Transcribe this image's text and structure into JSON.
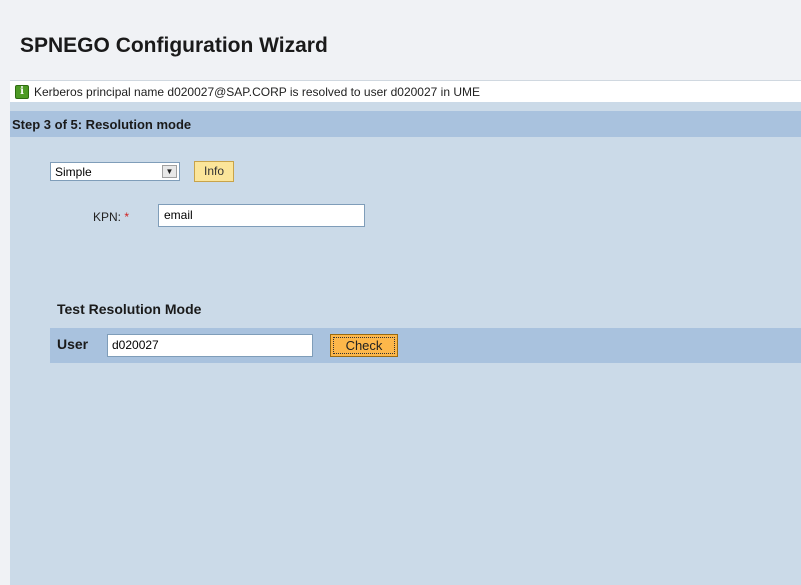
{
  "header": {
    "title": "SPNEGO Configuration Wizard"
  },
  "message": {
    "icon": "info-icon",
    "text": "Kerberos principal name d020027@SAP.CORP is resolved to user d020027 in UME",
    "color": "#4e9a25"
  },
  "step": {
    "label": "Step 3 of 5: Resolution mode"
  },
  "resolution": {
    "mode_value": "Simple",
    "info_label": "Info",
    "kpn_label": "KPN:",
    "required_marker": "*",
    "kpn_value": "email"
  },
  "test": {
    "title": "Test Resolution Mode",
    "user_label": "User",
    "user_value": "d020027",
    "check_label": "Check"
  },
  "colors": {
    "panel": "#cbdae8",
    "bar": "#a9c2de",
    "info_button": "#fbe59a",
    "check_button": "#fdb74a"
  }
}
